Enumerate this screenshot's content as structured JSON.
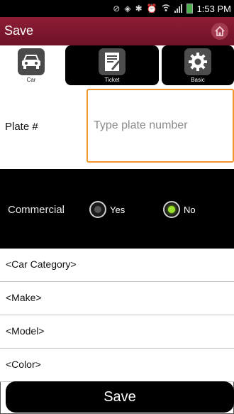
{
  "status_bar": {
    "time": "1:53 PM",
    "icons": [
      "do-not-disturb-icon",
      "vibrate-icon",
      "bluetooth-icon",
      "alarm-icon",
      "wifi-icon",
      "signal-icon",
      "battery-icon"
    ]
  },
  "title_bar": {
    "title": "Save",
    "home_icon": "home-icon"
  },
  "tabs": [
    {
      "label": "Car",
      "icon": "car-icon",
      "selected": true
    },
    {
      "label": "Ticket",
      "icon": "ticket-icon",
      "selected": false
    },
    {
      "label": "Basic",
      "icon": "gear-icon",
      "selected": false
    }
  ],
  "plate": {
    "label": "Plate #",
    "placeholder": "Type plate number",
    "value": ""
  },
  "commercial": {
    "label": "Commercial",
    "options": [
      {
        "label": "Yes",
        "selected": false
      },
      {
        "label": "No",
        "selected": true
      }
    ]
  },
  "fields": [
    {
      "label": "<Car Category>"
    },
    {
      "label": "<Make>"
    },
    {
      "label": "<Model>"
    },
    {
      "label": "<Color>"
    }
  ],
  "save_button": {
    "label": "Save"
  },
  "colors": {
    "title_bar": "#7a162c",
    "input_focus_border": "#f0962c",
    "radio_selected": "#9be02a"
  }
}
